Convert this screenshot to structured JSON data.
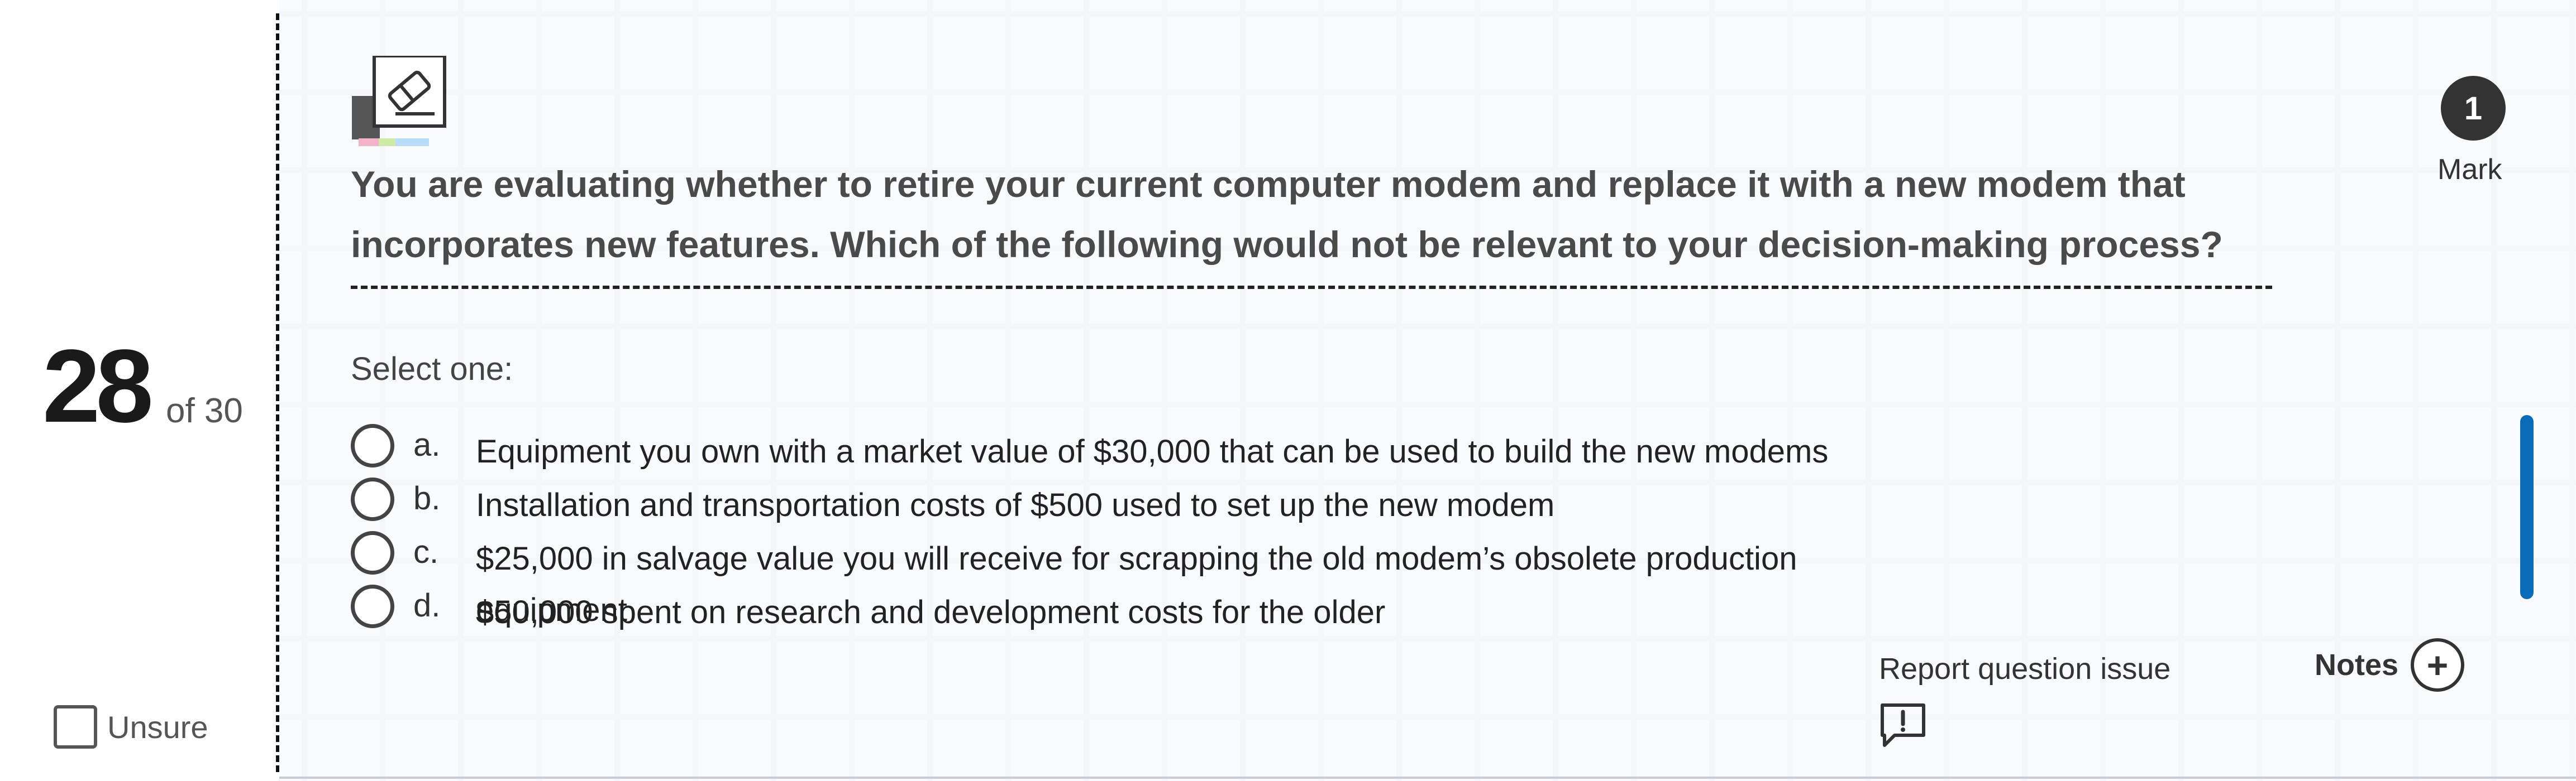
{
  "counter": {
    "current": "28",
    "of_label": "of 30"
  },
  "unsure": {
    "label": "Unsure",
    "checked": false
  },
  "toolbar": {
    "tool_icon": "eraser-tool-icon"
  },
  "question": {
    "text": "You are evaluating whether to retire your current computer modem and replace it with a new modem that incorporates new features. Which of the following would not be relevant to your decision-making process?",
    "instruction": "Select one:",
    "options": [
      {
        "letter": "a.",
        "text": "Equipment you own with a market value of $30,000 that can be used to build the new modems"
      },
      {
        "letter": "b.",
        "text": "Installation and transportation costs of $500 used to set up the new modem"
      },
      {
        "letter": "c.",
        "text": "$25,000 in salvage value you will receive for scrapping the old modem’s obsolete production equipment"
      },
      {
        "letter": "d.",
        "text": "$50,000 spent on research and development costs for the older"
      }
    ]
  },
  "mark": {
    "value": "1",
    "label": "Mark"
  },
  "actions": {
    "report_label": "Report question issue",
    "report_icon": "report-issue-icon",
    "notes_label": "Notes",
    "notes_icon": "plus-icon"
  },
  "colors": {
    "scrollbar": "#0a6cb8",
    "badge": "#333333"
  }
}
